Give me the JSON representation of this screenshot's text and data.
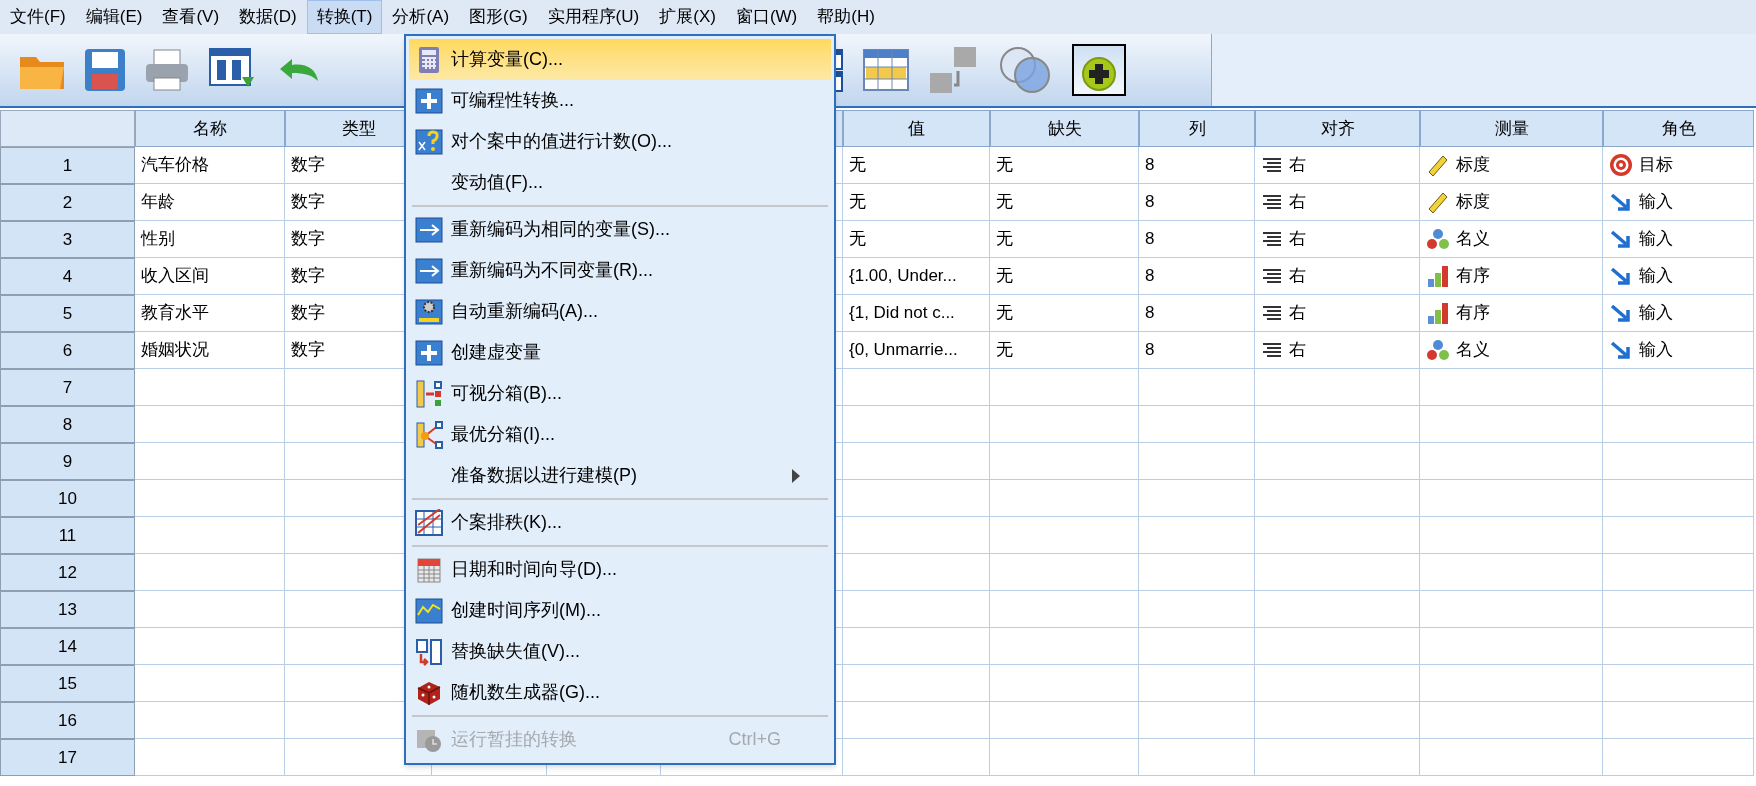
{
  "menu_bar": [
    {
      "label": "文件(F)",
      "selected": false
    },
    {
      "label": "编辑(E)",
      "selected": false
    },
    {
      "label": "查看(V)",
      "selected": false
    },
    {
      "label": "数据(D)",
      "selected": false
    },
    {
      "label": "转换(T)",
      "selected": true
    },
    {
      "label": "分析(A)",
      "selected": false
    },
    {
      "label": "图形(G)",
      "selected": false
    },
    {
      "label": "实用程序(U)",
      "selected": false
    },
    {
      "label": "扩展(X)",
      "selected": false
    },
    {
      "label": "窗口(W)",
      "selected": false
    },
    {
      "label": "帮助(H)",
      "selected": false
    }
  ],
  "transform_menu": {
    "items": [
      {
        "kind": "item",
        "label": "计算变量(C)...",
        "selected": true,
        "disabled": false,
        "submenu": false
      },
      {
        "kind": "item",
        "label": "可编程性转换...",
        "selected": false,
        "disabled": false,
        "submenu": false
      },
      {
        "kind": "item",
        "label": "对个案中的值进行计数(O)...",
        "selected": false,
        "disabled": false,
        "submenu": false
      },
      {
        "kind": "item",
        "label": "变动值(F)...",
        "selected": false,
        "disabled": false,
        "submenu": false
      },
      {
        "kind": "separator"
      },
      {
        "kind": "item",
        "label": "重新编码为相同的变量(S)...",
        "selected": false,
        "disabled": false,
        "submenu": false
      },
      {
        "kind": "item",
        "label": "重新编码为不同变量(R)...",
        "selected": false,
        "disabled": false,
        "submenu": false
      },
      {
        "kind": "item",
        "label": "自动重新编码(A)...",
        "selected": false,
        "disabled": false,
        "submenu": false
      },
      {
        "kind": "item",
        "label": "创建虚变量",
        "selected": false,
        "disabled": false,
        "submenu": false
      },
      {
        "kind": "item",
        "label": "可视分箱(B)...",
        "selected": false,
        "disabled": false,
        "submenu": false
      },
      {
        "kind": "item",
        "label": "最优分箱(I)...",
        "selected": false,
        "disabled": false,
        "submenu": false
      },
      {
        "kind": "item",
        "label": "准备数据以进行建模(P)",
        "selected": false,
        "disabled": false,
        "submenu": true
      },
      {
        "kind": "separator"
      },
      {
        "kind": "item",
        "label": "个案排秩(K)...",
        "selected": false,
        "disabled": false,
        "submenu": false
      },
      {
        "kind": "separator"
      },
      {
        "kind": "item",
        "label": "日期和时间向导(D)...",
        "selected": false,
        "disabled": false,
        "submenu": false
      },
      {
        "kind": "item",
        "label": "创建时间序列(M)...",
        "selected": false,
        "disabled": false,
        "submenu": false
      },
      {
        "kind": "item",
        "label": "替换缺失值(V)...",
        "selected": false,
        "disabled": false,
        "submenu": false
      },
      {
        "kind": "item",
        "label": "随机数生成器(G)...",
        "selected": false,
        "disabled": false,
        "submenu": false
      },
      {
        "kind": "separator"
      },
      {
        "kind": "item",
        "label": "运行暂挂的转换",
        "shortcut": "Ctrl+G",
        "selected": false,
        "disabled": true,
        "submenu": false
      }
    ]
  },
  "table": {
    "columns": [
      "名称",
      "类型",
      "值",
      "缺失",
      "列",
      "对齐",
      "测量",
      "角色"
    ],
    "rows": [
      {
        "number": "1",
        "name": "汽车价格",
        "type": "数字",
        "values": "无",
        "missing": "无",
        "columns": "8",
        "align": "右",
        "measure": {
          "label": "标度",
          "kind": "scale"
        },
        "role": {
          "label": "目标",
          "kind": "target"
        }
      },
      {
        "number": "2",
        "name": "年龄",
        "type": "数字",
        "values": "无",
        "missing": "无",
        "columns": "8",
        "align": "右",
        "measure": {
          "label": "标度",
          "kind": "scale"
        },
        "role": {
          "label": "输入",
          "kind": "input"
        }
      },
      {
        "number": "3",
        "name": "性别",
        "type": "数字",
        "values": "无",
        "missing": "无",
        "columns": "8",
        "align": "右",
        "measure": {
          "label": "名义",
          "kind": "nominal"
        },
        "role": {
          "label": "输入",
          "kind": "input"
        }
      },
      {
        "number": "4",
        "name": "收入区间",
        "type": "数字",
        "values": "{1.00, Under...",
        "missing": "无",
        "columns": "8",
        "align": "右",
        "measure": {
          "label": "有序",
          "kind": "ordinal"
        },
        "role": {
          "label": "输入",
          "kind": "input"
        }
      },
      {
        "number": "5",
        "name": "教育水平",
        "type": "数字",
        "values": "{1, Did not c...",
        "missing": "无",
        "columns": "8",
        "align": "右",
        "measure": {
          "label": "有序",
          "kind": "ordinal"
        },
        "role": {
          "label": "输入",
          "kind": "input"
        }
      },
      {
        "number": "6",
        "name": "婚姻状况",
        "type": "数字",
        "values": "{0, Unmarrie...",
        "missing": "无",
        "columns": "8",
        "align": "右",
        "measure": {
          "label": "名义",
          "kind": "nominal"
        },
        "role": {
          "label": "输入",
          "kind": "input"
        }
      },
      {
        "number": "7"
      },
      {
        "number": "8"
      },
      {
        "number": "9"
      },
      {
        "number": "10"
      },
      {
        "number": "11"
      },
      {
        "number": "12"
      },
      {
        "number": "13"
      },
      {
        "number": "14"
      },
      {
        "number": "15"
      },
      {
        "number": "16"
      },
      {
        "number": "17"
      }
    ]
  }
}
